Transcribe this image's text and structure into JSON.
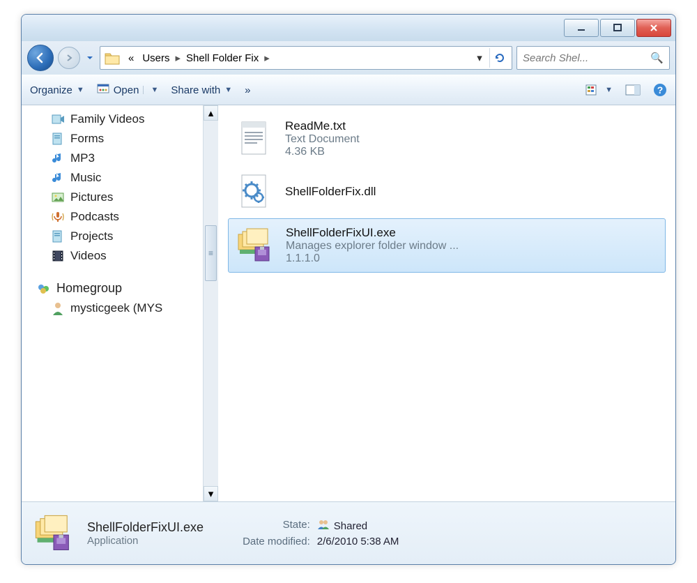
{
  "breadcrumb": {
    "prefix": "«",
    "parent": "Users",
    "current": "Shell Folder Fix"
  },
  "search": {
    "placeholder": "Search Shel..."
  },
  "toolbar": {
    "organize": "Organize",
    "open": "Open",
    "share": "Share with",
    "more": "»"
  },
  "sidebar": {
    "items": [
      {
        "label": "Family Videos",
        "icon": "video"
      },
      {
        "label": "Forms",
        "icon": "doc"
      },
      {
        "label": "MP3",
        "icon": "music"
      },
      {
        "label": "Music",
        "icon": "music"
      },
      {
        "label": "Pictures",
        "icon": "picture"
      },
      {
        "label": "Podcasts",
        "icon": "podcast"
      },
      {
        "label": "Projects",
        "icon": "doc"
      },
      {
        "label": "Videos",
        "icon": "film"
      }
    ],
    "homegroup": "Homegroup",
    "user": "mysticgeek (MYS"
  },
  "files": [
    {
      "name": "ReadMe.txt",
      "type": "Text Document",
      "meta": "4.36 KB",
      "icon": "txt",
      "selected": false
    },
    {
      "name": "ShellFolderFix.dll",
      "type": "",
      "meta": "",
      "icon": "dll",
      "selected": false
    },
    {
      "name": "ShellFolderFixUI.exe",
      "type": "Manages explorer folder window ...",
      "meta": "1.1.1.0",
      "icon": "exe",
      "selected": true
    }
  ],
  "details": {
    "name": "ShellFolderFixUI.exe",
    "type": "Application",
    "state_label": "State:",
    "state_value": "Shared",
    "modified_label": "Date modified:",
    "modified_value": "2/6/2010 5:38 AM"
  }
}
